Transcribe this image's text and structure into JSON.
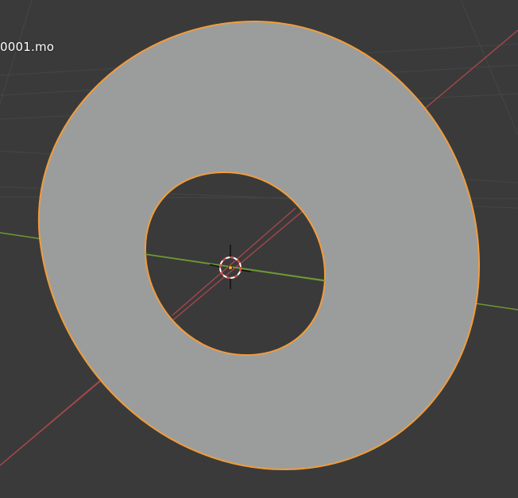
{
  "viewport": {
    "object_label": "0001.mo",
    "colors": {
      "background": "#3a3a3a",
      "grid_line": "#454545",
      "x_axis": "#a3474c",
      "y_axis": "#6f9a32",
      "mesh_fill": "#9a9c9c",
      "selection_outline": "#f29c3a",
      "origin_dot": "#f7a03a",
      "cursor_ring_red": "#e04848",
      "cursor_ring_white": "#ffffff"
    },
    "objects": [
      {
        "name": "ring-mesh",
        "selected": true
      },
      {
        "name": "3d-cursor"
      }
    ]
  }
}
